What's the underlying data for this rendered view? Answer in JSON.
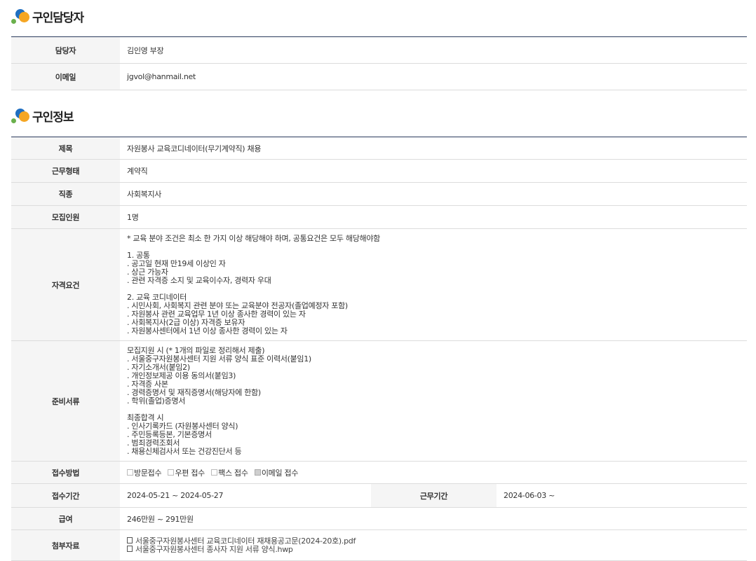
{
  "contact": {
    "title": "구인담당자",
    "rows": [
      {
        "label": "담당자",
        "value": "김인영 부장"
      },
      {
        "label": "이메일",
        "value": "jgvol@hanmail.net"
      }
    ]
  },
  "job": {
    "title": "구인정보",
    "subject_label": "제목",
    "subject": "자원봉사 교육코디네이터(무기계약직) 채용",
    "type_label": "근무형태",
    "type": "계약직",
    "category_label": "직종",
    "category": "사회복지사",
    "headcount_label": "모집인원",
    "headcount": "1명",
    "qualification_label": "자격요건",
    "qualification": "* 교육 분야 조건은 최소 한 가지 이상 해당해야 하며, 공통요건은 모두 해당해야함\n\n 1. 공통\n . 공고일 현재 만19세 이상인 자\n . 상근 가능자\n . 관련 자격증 소지 및 교육이수자, 경력자 우대\n\n 2. 교육 코디네이터\n . 시민사회, 사회복지 관련 분야 또는 교육분야 전공자(졸업예정자 포함)\n . 자원봉사 관련 교육업무 1년 이상 종사한 경력이 있는 자\n . 사회복지사(2급 이상) 자격증 보유자\n . 자원봉사센터에서 1년 이상 종사한 경력이 있는 자",
    "documents_label": "준비서류",
    "documents": "모집지원 시 (* 1개의 파일로 정리해서 제출)\n . 서울중구자원봉사센터 지원 서류 양식 표준 이력서(붙임1)\n . 자기소개서(붙임2)\n . 개인정보제공 이용 동의서(붙임3)\n . 자격증 사본\n . 경력증명서 및 재직증명서(해당자에 한함)\n . 학위(졸업)증명서\n\n최종합격 시\n . 인사기록카드 (자원봉사센터 양식)\n . 주민등록등본, 기본증명서\n . 범죄경력조회서\n . 채용신체검사서 또는 건강진단서 등",
    "method_label": "접수방법",
    "methods": [
      {
        "label": "방문접수",
        "checked": false
      },
      {
        "label": "우편 접수",
        "checked": false
      },
      {
        "label": "팩스 접수",
        "checked": false
      },
      {
        "label": "이메일 접수",
        "checked": true
      }
    ],
    "period_label": "접수기간",
    "period": "2024-05-21 ~ 2024-05-27",
    "work_period_label": "근무기간",
    "work_period": "2024-06-03 ~",
    "salary_label": "급여",
    "salary": "246만원 ~ 291만원",
    "attach_label": "첨부자료",
    "attachments": [
      "서울중구자원봉사센터 교육코디네이터 재채용공고문(2024-20호).pdf",
      "서울중구자원봉사센터 종사자 지원 서류 양식.hwp"
    ]
  }
}
